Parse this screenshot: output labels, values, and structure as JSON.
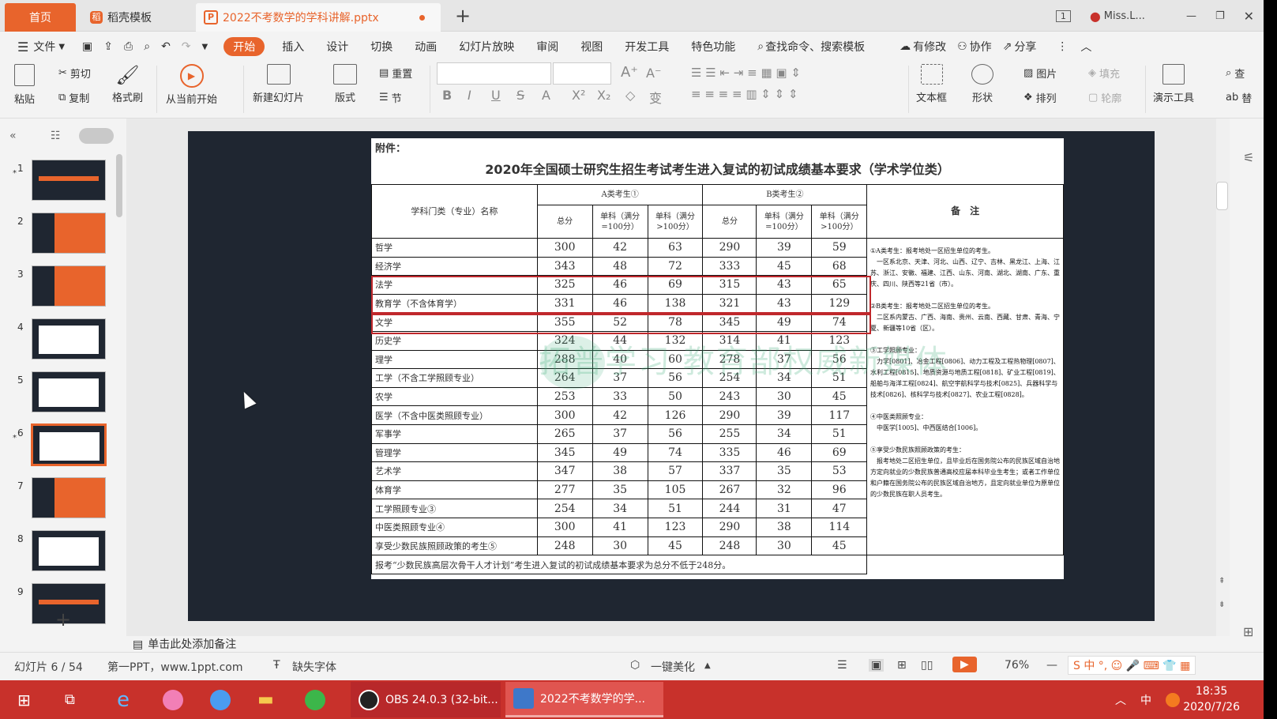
{
  "titlebar": {
    "tabs": [
      {
        "label": "首页"
      },
      {
        "label": "稻壳模板"
      },
      {
        "label": "2022不考数学的学科讲解.pptx"
      }
    ],
    "page_indicator": "1",
    "user": "Miss.L..."
  },
  "menu": {
    "file": "文件",
    "items": [
      "开始",
      "插入",
      "设计",
      "切换",
      "动画",
      "幻灯片放映",
      "审阅",
      "视图",
      "开发工具",
      "特色功能"
    ],
    "search": "查找命令、搜索模板",
    "changed": "有修改",
    "collab": "协作",
    "share": "分享"
  },
  "ribbon": {
    "paste": "粘贴",
    "cut": "剪切",
    "copy": "复制",
    "format_painter": "格式刷",
    "from_start": "从当前开始",
    "new_slide": "新建幻灯片",
    "layout": "版式",
    "reset": "重置",
    "section": "节",
    "textbox": "文本框",
    "shape": "形状",
    "picture": "图片",
    "fill": "填充",
    "arrange": "排列",
    "outline": "轮廓",
    "presenter_tools": "演示工具",
    "find": "查",
    "replace": "替"
  },
  "thumbnails": [
    {
      "num": "1",
      "star": true
    },
    {
      "num": "2"
    },
    {
      "num": "3"
    },
    {
      "num": "4"
    },
    {
      "num": "5"
    },
    {
      "num": "6",
      "star": true,
      "selected": true
    },
    {
      "num": "7"
    },
    {
      "num": "8"
    },
    {
      "num": "9"
    }
  ],
  "slide": {
    "attachment": "附件：",
    "title": "2020年全国硕士研究生招生考试考生进入复试的初试成绩基本要求（学术学位类）",
    "headers": {
      "subject": "学科门类（专业）名称",
      "groupA": "A类考生①",
      "groupB": "B类考生②",
      "total": "总分",
      "single100": "单科（满分=100分）",
      "single_over": "单科（满分>100分）",
      "remarks": "备　注"
    },
    "rows": [
      {
        "name": "哲学",
        "v": [
          "300",
          "42",
          "63",
          "290",
          "39",
          "59"
        ]
      },
      {
        "name": "经济学",
        "v": [
          "343",
          "48",
          "72",
          "333",
          "45",
          "68"
        ]
      },
      {
        "name": "法学",
        "v": [
          "325",
          "46",
          "69",
          "315",
          "43",
          "65"
        ]
      },
      {
        "name": "教育学（不含体育学）",
        "v": [
          "331",
          "46",
          "138",
          "321",
          "43",
          "129"
        ]
      },
      {
        "name": "文学",
        "v": [
          "355",
          "52",
          "78",
          "345",
          "49",
          "74"
        ]
      },
      {
        "name": "历史学",
        "v": [
          "324",
          "44",
          "132",
          "314",
          "41",
          "123"
        ]
      },
      {
        "name": "理学",
        "v": [
          "288",
          "40",
          "60",
          "278",
          "37",
          "56"
        ]
      },
      {
        "name": "工学（不含工学照顾专业）",
        "v": [
          "264",
          "37",
          "56",
          "254",
          "34",
          "51"
        ]
      },
      {
        "name": "农学",
        "v": [
          "253",
          "33",
          "50",
          "243",
          "30",
          "45"
        ]
      },
      {
        "name": "医学（不含中医类照顾专业）",
        "v": [
          "300",
          "42",
          "126",
          "290",
          "39",
          "117"
        ]
      },
      {
        "name": "军事学",
        "v": [
          "265",
          "37",
          "56",
          "255",
          "34",
          "51"
        ]
      },
      {
        "name": "管理学",
        "v": [
          "345",
          "49",
          "74",
          "335",
          "46",
          "69"
        ]
      },
      {
        "name": "艺术学",
        "v": [
          "347",
          "38",
          "57",
          "337",
          "35",
          "53"
        ]
      },
      {
        "name": "体育学",
        "v": [
          "277",
          "35",
          "105",
          "267",
          "32",
          "96"
        ]
      },
      {
        "name": "工学照顾专业③",
        "v": [
          "254",
          "34",
          "51",
          "244",
          "31",
          "47"
        ]
      },
      {
        "name": "中医类照顾专业④",
        "v": [
          "300",
          "41",
          "123",
          "290",
          "38",
          "114"
        ]
      },
      {
        "name": "享受少数民族照顾政策的考生⑤",
        "v": [
          "248",
          "30",
          "45",
          "248",
          "30",
          "45"
        ]
      }
    ],
    "footer": "报考“少数民族高层次骨干人才计划”考生进入复试的初试成绩基本要求为总分不低于248分。",
    "remarks_text": "①A类考生：报考地处一区招生单位的考生。\n　一区系北京、天津、河北、山西、辽宁、吉林、黑龙江、上海、江苏、浙江、安徽、福建、江西、山东、河南、湖北、湖南、广东、重庆、四川、陕西等21省（市）。\n\n②B类考生：报考地处二区招生单位的考生。\n　二区系内蒙古、广西、海南、贵州、云南、西藏、甘肃、青海、宁夏、新疆等10省（区）。\n\n③工学照顾专业：\n　力学[0801]、冶金工程[0806]、动力工程及工程热物理[0807]、水利工程[0815]、地质资源与地质工程[0818]、矿业工程[0819]、船舶与海洋工程[0824]、航空宇航科学与技术[0825]、兵器科学与技术[0826]、核科学与技术[0827]、农业工程[0828]。\n\n④中医类照顾专业：\n　中医学[1005]、中西医结合[1006]。\n\n⑤享受少数民族照顾政策的考生：\n　报考地处二区招生单位，且毕业后在国务院公布的民族区域自治地方定向就业的少数民族普通高校应届本科毕业生考生；或者工作单位和户籍在国务院公布的民族区域自治地方，且定向就业单位为原单位的少数民族在职人员考生。",
    "watermark": "拓普学习 教育部权威新媒体"
  },
  "notes_placeholder": "单击此处添加备注",
  "status": {
    "slide_counter": "幻灯片 6 / 54",
    "theme": "第一PPT，www.1ppt.com",
    "missing_font": "缺失字体",
    "beautify": "一键美化",
    "zoom": "76%"
  },
  "taskbar": {
    "obs": "OBS 24.0.3 (32-bit...",
    "ppt": "2022不考数学的学...",
    "ime": "中",
    "time": "18:35",
    "date": "2020/7/26"
  },
  "colors": {
    "accent": "#e8642c",
    "taskbar": "#c8312b",
    "highlight": "#c0282c"
  }
}
